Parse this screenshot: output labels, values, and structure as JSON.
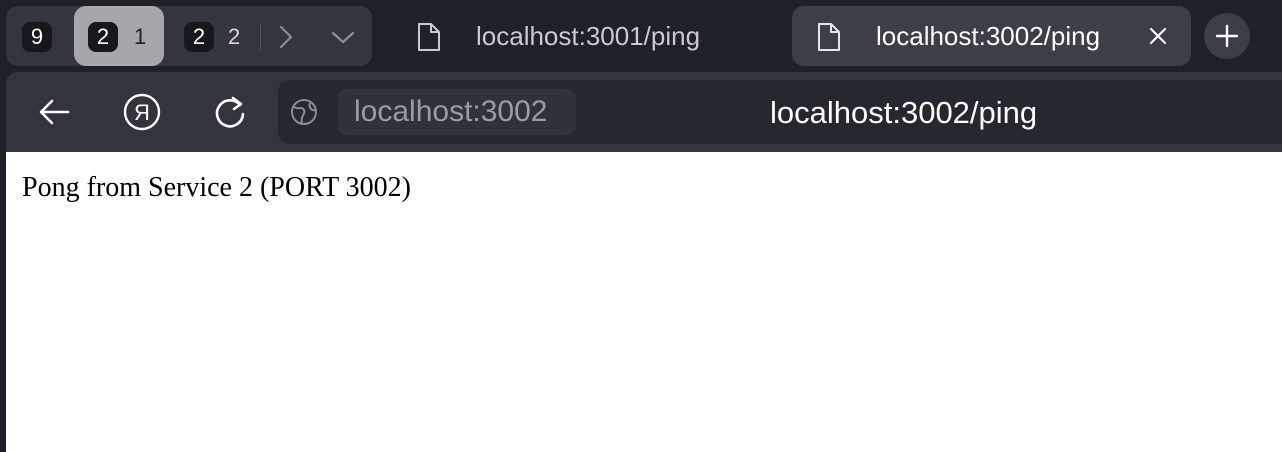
{
  "tab_strip": {
    "group_badges": [
      {
        "badge": "9",
        "count": ""
      },
      {
        "badge": "2",
        "count": "1"
      },
      {
        "badge": "2",
        "count": "2"
      }
    ],
    "tabs": [
      {
        "title": "localhost:3001/ping",
        "active": false
      },
      {
        "title": "localhost:3002/ping",
        "active": true
      }
    ],
    "icons": {
      "forward": "chevron-right-icon",
      "more": "chevron-down-icon",
      "page": "document-icon",
      "close": "close-icon",
      "new_tab": "plus-icon"
    }
  },
  "toolbar": {
    "icons": {
      "back": "arrow-left-icon",
      "yandex": "yandex-logo-icon",
      "reload": "reload-icon",
      "site": "globe-icon"
    },
    "host": "localhost:3002",
    "url": "localhost:3002/ping"
  },
  "page": {
    "text": "Pong from Service 2 (PORT 3002)"
  },
  "colors": {
    "frame": "#1f2128",
    "tab_group_bg": "#34363f",
    "active_group": "#a6a7ad",
    "active_tab": "#3c3e48",
    "toolbar": "#33353e",
    "omnibox": "#262830",
    "content_bg": "#ffffff"
  }
}
